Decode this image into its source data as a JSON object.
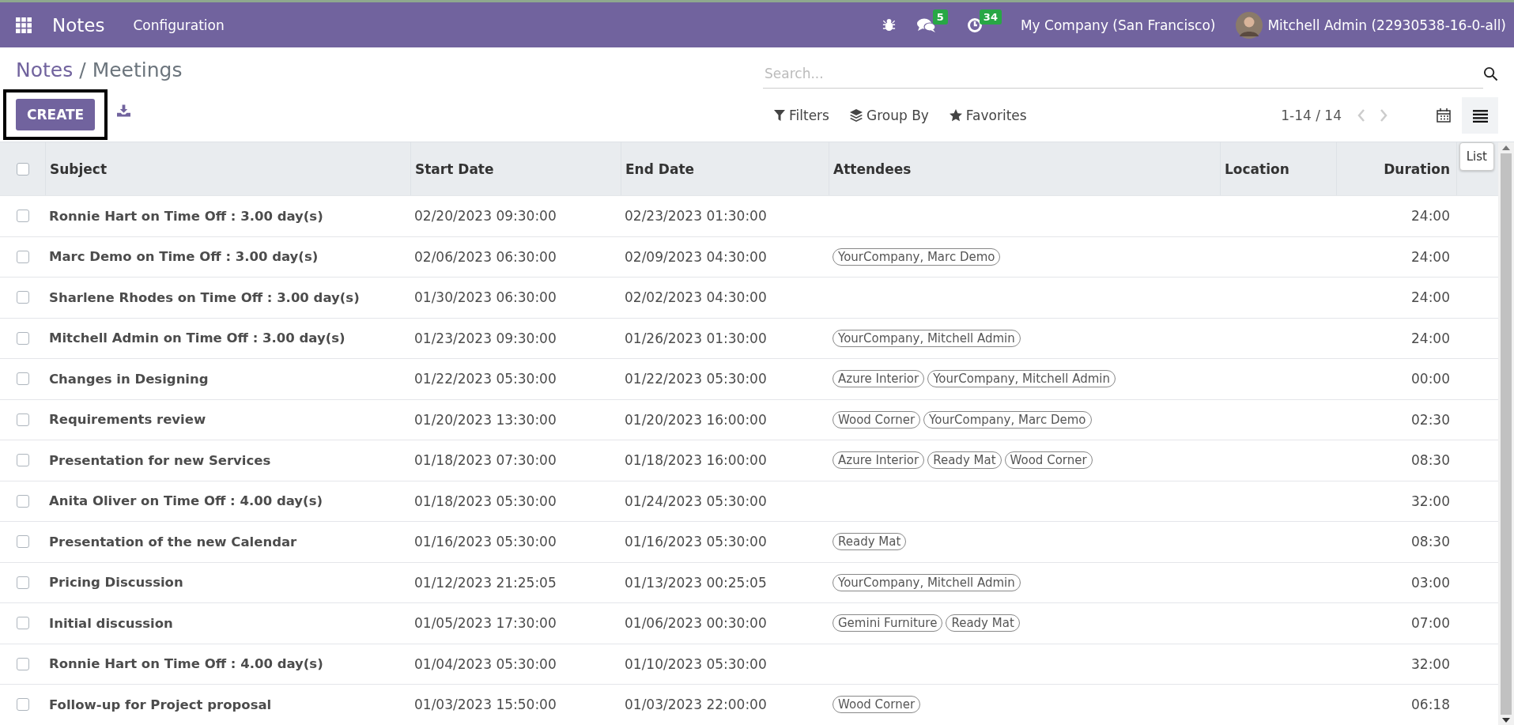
{
  "navbar": {
    "brand": "Notes",
    "menu": [
      "Configuration"
    ],
    "messages_badge": "5",
    "activities_badge": "34",
    "company": "My Company (San Francisco)",
    "user": "Mitchell Admin (22930538-16-0-all)"
  },
  "breadcrumb": {
    "parent": "Notes",
    "separator": "/",
    "current": "Meetings"
  },
  "create_button": "CREATE",
  "search": {
    "placeholder": "Search..."
  },
  "search_options": [
    "Filters",
    "Group By",
    "Favorites"
  ],
  "pager": "1-14 / 14",
  "views": [
    {
      "kind": "calendar",
      "selected": false
    },
    {
      "kind": "list",
      "selected": true
    }
  ],
  "tooltip": "List",
  "table": {
    "select_all_checked": false,
    "columns": [
      "Subject",
      "Start Date",
      "End Date",
      "Attendees",
      "Location",
      "Duration"
    ],
    "rows": [
      {
        "checked": false,
        "subject": "Ronnie Hart on Time Off : 3.00 day(s)",
        "start": "02/20/2023 09:30:00",
        "end": "02/23/2023 01:30:00",
        "attendees": [],
        "duration": "24:00"
      },
      {
        "checked": false,
        "subject": "Marc Demo on Time Off : 3.00 day(s)",
        "start": "02/06/2023 06:30:00",
        "end": "02/09/2023 04:30:00",
        "attendees": [
          "YourCompany, Marc Demo"
        ],
        "duration": "24:00"
      },
      {
        "checked": false,
        "subject": "Sharlene Rhodes on Time Off : 3.00 day(s)",
        "start": "01/30/2023 06:30:00",
        "end": "02/02/2023 04:30:00",
        "attendees": [],
        "duration": "24:00"
      },
      {
        "checked": false,
        "subject": "Mitchell Admin on Time Off : 3.00 day(s)",
        "start": "01/23/2023 09:30:00",
        "end": "01/26/2023 01:30:00",
        "attendees": [
          "YourCompany, Mitchell Admin"
        ],
        "duration": "24:00"
      },
      {
        "checked": false,
        "subject": "Changes in Designing",
        "start": "01/22/2023 05:30:00",
        "end": "01/22/2023 05:30:00",
        "attendees": [
          "Azure Interior",
          "YourCompany, Mitchell Admin"
        ],
        "duration": "00:00"
      },
      {
        "checked": false,
        "subject": "Requirements review",
        "start": "01/20/2023 13:30:00",
        "end": "01/20/2023 16:00:00",
        "attendees": [
          "Wood Corner",
          "YourCompany, Marc Demo"
        ],
        "duration": "02:30"
      },
      {
        "checked": false,
        "subject": "Presentation for new Services",
        "start": "01/18/2023 07:30:00",
        "end": "01/18/2023 16:00:00",
        "attendees": [
          "Azure Interior",
          "Ready Mat",
          "Wood Corner"
        ],
        "duration": "08:30"
      },
      {
        "checked": false,
        "subject": "Anita Oliver on Time Off : 4.00 day(s)",
        "start": "01/18/2023 05:30:00",
        "end": "01/24/2023 05:30:00",
        "attendees": [],
        "duration": "32:00"
      },
      {
        "checked": false,
        "subject": "Presentation of the new Calendar",
        "start": "01/16/2023 05:30:00",
        "end": "01/16/2023 05:30:00",
        "attendees": [
          "Ready Mat"
        ],
        "duration": "08:30"
      },
      {
        "checked": false,
        "subject": "Pricing Discussion",
        "start": "01/12/2023 21:25:05",
        "end": "01/13/2023 00:25:05",
        "attendees": [
          "YourCompany, Mitchell Admin"
        ],
        "duration": "03:00"
      },
      {
        "checked": false,
        "subject": "Initial discussion",
        "start": "01/05/2023 17:30:00",
        "end": "01/06/2023 00:30:00",
        "attendees": [
          "Gemini Furniture",
          "Ready Mat"
        ],
        "duration": "07:00"
      },
      {
        "checked": false,
        "subject": "Ronnie Hart on Time Off : 4.00 day(s)",
        "start": "01/04/2023 05:30:00",
        "end": "01/10/2023 05:30:00",
        "attendees": [],
        "duration": "32:00"
      },
      {
        "checked": false,
        "subject": "Follow-up for Project proposal",
        "start": "01/03/2023 15:50:00",
        "end": "01/03/2023 22:00:00",
        "attendees": [
          "Wood Corner"
        ],
        "duration": "06:18"
      }
    ]
  }
}
